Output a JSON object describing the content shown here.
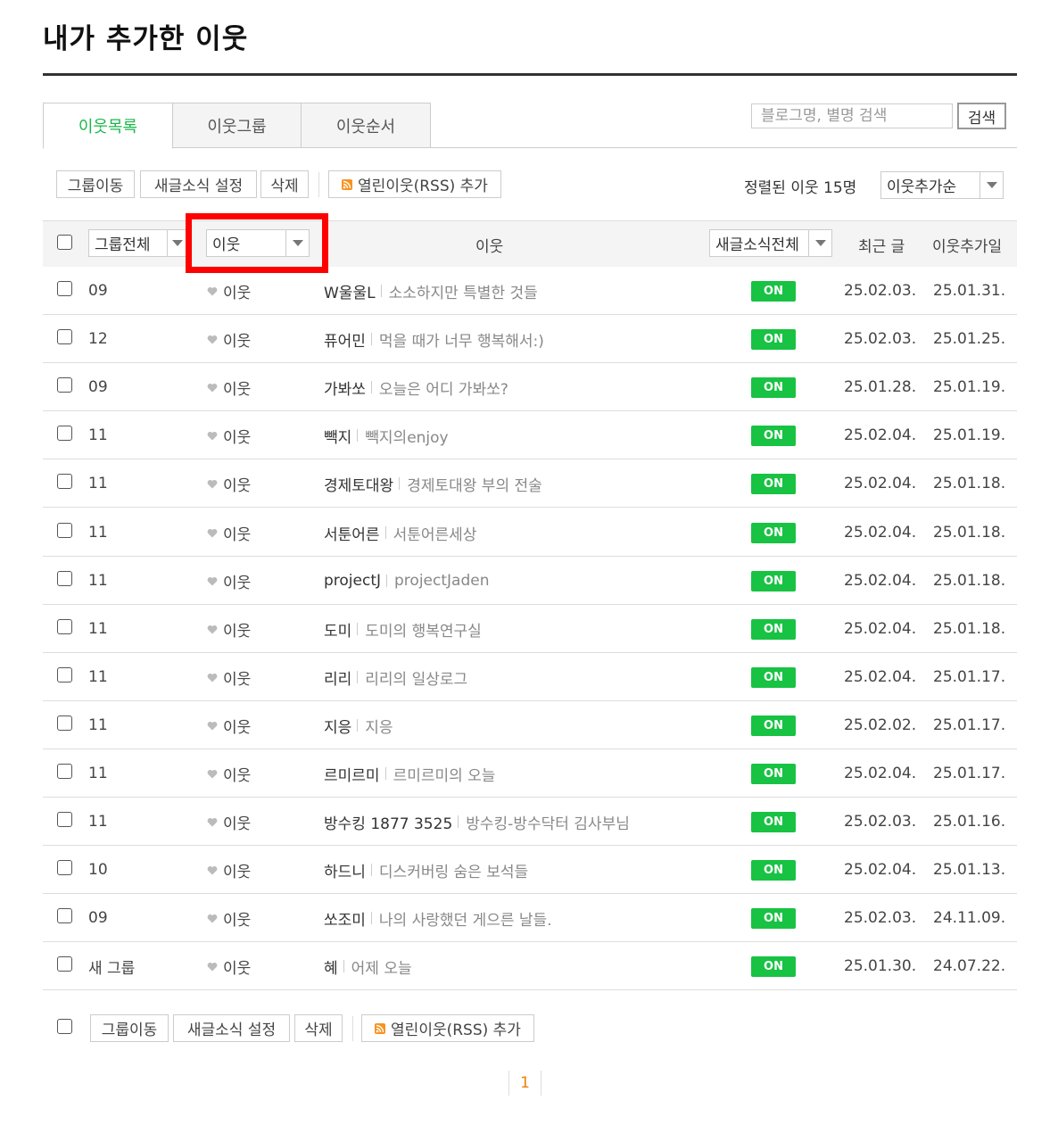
{
  "page": {
    "title": "내가 추가한 이웃"
  },
  "tabs": [
    {
      "label": "이웃목록",
      "active": true
    },
    {
      "label": "이웃그룹",
      "active": false
    },
    {
      "label": "이웃순서",
      "active": false
    }
  ],
  "search": {
    "placeholder": "블로그명, 별명 검색",
    "button": "검색"
  },
  "toolbar": {
    "group_move": "그룹이동",
    "feed_setting": "새글소식 설정",
    "delete": "삭제",
    "rss_add": "열린이웃(RSS) 추가",
    "count_text": "정렬된 이웃 15명",
    "sort_selected": "이웃추가순"
  },
  "header": {
    "group_filter": "그룹전체",
    "type_filter": "이웃",
    "neighbor": "이웃",
    "feed_filter": "새글소식전체",
    "recent_post": "최근 글",
    "added_date": "이웃추가일"
  },
  "rows": [
    {
      "group": "09",
      "type": "이웃",
      "nickname": "W울울L",
      "blog": "소소하지만 특별한 것들",
      "feed": "ON",
      "recent": "25.02.03.",
      "added": "25.01.31."
    },
    {
      "group": "12",
      "type": "이웃",
      "nickname": "퓨어민",
      "blog": "먹을 때가 너무 행복해서:)",
      "feed": "ON",
      "recent": "25.02.03.",
      "added": "25.01.25."
    },
    {
      "group": "09",
      "type": "이웃",
      "nickname": "가봐쏘",
      "blog": "오늘은 어디 가봐쏘?",
      "feed": "ON",
      "recent": "25.01.28.",
      "added": "25.01.19."
    },
    {
      "group": "11",
      "type": "이웃",
      "nickname": "빽지",
      "blog": "빽지의enjoy",
      "feed": "ON",
      "recent": "25.02.04.",
      "added": "25.01.19."
    },
    {
      "group": "11",
      "type": "이웃",
      "nickname": "경제토대왕",
      "blog": "경제토대왕 부의 전술",
      "feed": "ON",
      "recent": "25.02.04.",
      "added": "25.01.18."
    },
    {
      "group": "11",
      "type": "이웃",
      "nickname": "서툰어른",
      "blog": "서툰어른세상",
      "feed": "ON",
      "recent": "25.02.04.",
      "added": "25.01.18."
    },
    {
      "group": "11",
      "type": "이웃",
      "nickname": "projectJ",
      "blog": "projectJaden",
      "feed": "ON",
      "recent": "25.02.04.",
      "added": "25.01.18."
    },
    {
      "group": "11",
      "type": "이웃",
      "nickname": "도미",
      "blog": "도미의 행복연구실",
      "feed": "ON",
      "recent": "25.02.04.",
      "added": "25.01.18."
    },
    {
      "group": "11",
      "type": "이웃",
      "nickname": "리리",
      "blog": "리리의 일상로그",
      "feed": "ON",
      "recent": "25.02.04.",
      "added": "25.01.17."
    },
    {
      "group": "11",
      "type": "이웃",
      "nickname": "지응",
      "blog": "지응",
      "feed": "ON",
      "recent": "25.02.02.",
      "added": "25.01.17."
    },
    {
      "group": "11",
      "type": "이웃",
      "nickname": "르미르미",
      "blog": "르미르미의 오늘",
      "feed": "ON",
      "recent": "25.02.04.",
      "added": "25.01.17."
    },
    {
      "group": "11",
      "type": "이웃",
      "nickname": "방수킹 1877 3525",
      "blog": "방수킹-방수닥터 김사부님",
      "feed": "ON",
      "recent": "25.02.03.",
      "added": "25.01.16."
    },
    {
      "group": "10",
      "type": "이웃",
      "nickname": "하드니",
      "blog": "디스커버링 숨은 보석들",
      "feed": "ON",
      "recent": "25.02.04.",
      "added": "25.01.13."
    },
    {
      "group": "09",
      "type": "이웃",
      "nickname": "쏘조미",
      "blog": "나의 사랑했던 게으른 날들.",
      "feed": "ON",
      "recent": "25.02.03.",
      "added": "24.11.09."
    },
    {
      "group": "새 그룹",
      "type": "이웃",
      "nickname": "혜",
      "blog": "어제 오늘",
      "feed": "ON",
      "recent": "25.01.30.",
      "added": "24.07.22."
    }
  ],
  "pagination": {
    "current": "1"
  },
  "colors": {
    "accent_green": "#1bb74a",
    "on_badge": "#18c243",
    "page_active": "#f07d00",
    "highlight": "#ff0000"
  }
}
